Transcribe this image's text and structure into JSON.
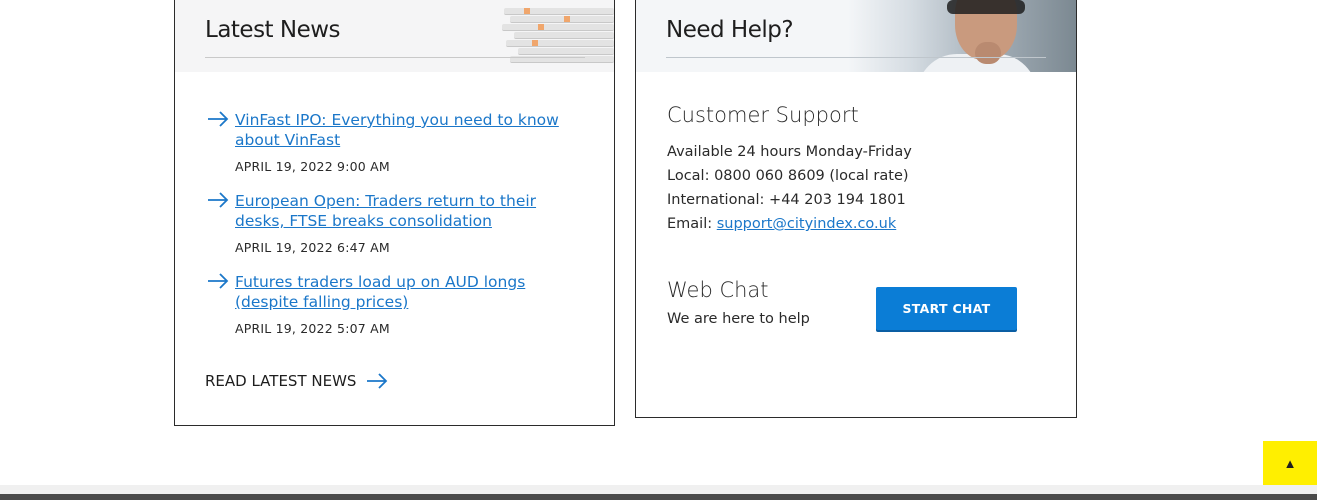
{
  "news": {
    "title": "Latest News",
    "items": [
      {
        "headline": "VinFast IPO: Everything you need to know about VinFast",
        "date": "APRIL 19, 2022 9:00 AM"
      },
      {
        "headline": "European Open: Traders return to their desks, FTSE breaks consolidation",
        "date": "APRIL 19, 2022 6:47 AM"
      },
      {
        "headline": "Futures traders load up on AUD longs (despite falling prices)",
        "date": "APRIL 19, 2022 5:07 AM"
      }
    ],
    "read_more": "READ LATEST NEWS"
  },
  "help": {
    "title": "Need Help?",
    "support_title": "Customer Support",
    "availability": "Available 24 hours Monday-Friday",
    "local": "Local: 0800 060 8609 (local rate)",
    "international": "International: +44 203 194 1801",
    "email_label": "Email: ",
    "email": "support@cityindex.co.uk",
    "chat_title": "Web Chat",
    "chat_sub": "We are here to help",
    "chat_button": "START CHAT"
  },
  "back_to_top": "▲",
  "colors": {
    "accent": "#0b7dd6",
    "link": "#1b77c9",
    "back_to_top": "#ffef00"
  }
}
